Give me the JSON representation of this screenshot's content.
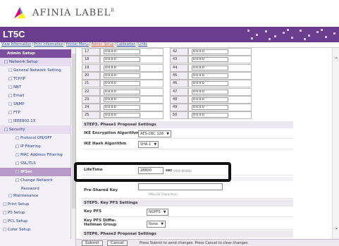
{
  "logo": {
    "text": "AFINIA LABEL",
    "mark": "R"
  },
  "header": {
    "title": "LT5C"
  },
  "nav": {
    "links": [
      "View Information",
      "Print Information",
      "Printer Menu",
      "Admin Setup",
      "Calibration",
      "Links"
    ],
    "active_index": 3
  },
  "sidebar": {
    "items": [
      {
        "label": "Admin Setup",
        "type": "header"
      },
      {
        "label": "□ Network Setup",
        "type": "parent"
      },
      {
        "label": "□ General Network Setting",
        "type": "child"
      },
      {
        "label": "□ TCP/IP",
        "type": "child"
      },
      {
        "label": "□ NBT",
        "type": "child"
      },
      {
        "label": "□ Email",
        "type": "child"
      },
      {
        "label": "□ SNMP",
        "type": "child"
      },
      {
        "label": "□ FTP",
        "type": "child"
      },
      {
        "label": "□ IEEE802.1X",
        "type": "child"
      },
      {
        "label": "□ Security",
        "type": "parent"
      },
      {
        "label": "□ Protocol ON/OFF",
        "type": "grandchild"
      },
      {
        "label": "□ IP Filtering",
        "type": "grandchild"
      },
      {
        "label": "□ MAC Address Filtering",
        "type": "grandchild"
      },
      {
        "label": "□ SSL/TLS",
        "type": "grandchild"
      },
      {
        "label": "□ IPSec",
        "type": "highlight"
      },
      {
        "label": "□ Change Network",
        "type": "grandchild"
      },
      {
        "label": "Password",
        "type": "grandchild-cont"
      },
      {
        "label": "□ Maintenance",
        "type": "child"
      },
      {
        "label": "□ Print Setup",
        "type": "top"
      },
      {
        "label": "□ PS Setup",
        "type": "top"
      },
      {
        "label": "□ PCL Setup",
        "type": "top"
      },
      {
        "label": "□ Color Setup",
        "type": "top"
      }
    ]
  },
  "ip_table": {
    "rows": [
      {
        "left_num": "17",
        "left_val": "0.0.0.0",
        "right_num": "42",
        "right_val": "0.0.0.0"
      },
      {
        "left_num": "18",
        "left_val": "0.0.0.0",
        "right_num": "43",
        "right_val": "0.0.0.0"
      },
      {
        "left_num": "19",
        "left_val": "0.0.0.0",
        "right_num": "44",
        "right_val": "0.0.0.0"
      },
      {
        "left_num": "20",
        "left_val": "0.0.0.0",
        "right_num": "45",
        "right_val": "0.0.0.0"
      },
      {
        "left_num": "21",
        "left_val": "0.0.0.0",
        "right_num": "46",
        "right_val": "0.0.0.0"
      },
      {
        "left_num": "22",
        "left_val": "0.0.0.0",
        "right_num": "47",
        "right_val": "0.0.0.0"
      },
      {
        "left_num": "23",
        "left_val": "0.0.0.0",
        "right_num": "48",
        "right_val": "0.0.0.0"
      },
      {
        "left_num": "24",
        "left_val": "0.0.0.0",
        "right_num": "49",
        "right_val": "0.0.0.0"
      },
      {
        "left_num": "25",
        "left_val": "0.0.0.0",
        "right_num": "50",
        "right_val": "0.0.0.0"
      }
    ]
  },
  "step3": {
    "heading": "STEP3.  Phase1 Proposal Settings",
    "ike_encryption_label": "IKE Encryption Algorithm",
    "ike_encryption_value": "AES-CBC 128",
    "ike_hash_label": "IKE Hash Algorithm",
    "ike_hash_value": "SHA-1",
    "lifetime_label": "LifeTime",
    "lifetime_value": "28800",
    "lifetime_unit": "sec",
    "lifetime_hint": "(600-86400)"
  },
  "step4": {
    "psk_label": "Pre-Shared Key",
    "psk_hint": "(Max 64 Characters)"
  },
  "step5": {
    "heading": "STEP5.  Key PFS Settings",
    "key_pfs_label": "Key PFS",
    "key_pfs_value": "NOPFS",
    "dh_label": "Key PFS Diffie-Hellman Group",
    "dh_value": "None"
  },
  "step6": {
    "heading": "STEP6.  Phase2 Proposal Settings"
  },
  "bottom": {
    "submit_label": "Submit",
    "cancel_label": "Cancel",
    "message": "Press Submit to send changes. Press Cancel to clear changes."
  },
  "colors": {
    "title_bar": "#6b3d8e",
    "sidebar_header": "#7b4f9d",
    "sidebar_highlight": "#b89ac9",
    "link": "#1a3a9a"
  }
}
